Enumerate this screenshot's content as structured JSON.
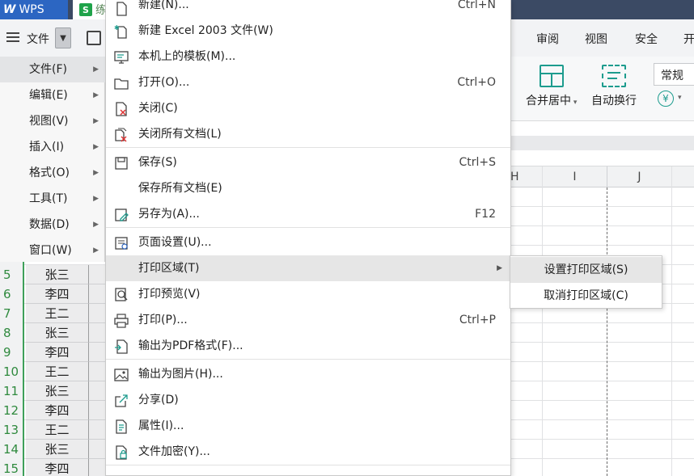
{
  "titlebar": {
    "app_label": "WPS",
    "doc_icon": "S",
    "doc_label": "练"
  },
  "menubar": {
    "file_label": "文件",
    "tabs": [
      "审阅",
      "视图",
      "安全",
      "开"
    ]
  },
  "ribbon": {
    "merge_label": "合并居中",
    "wrap_label": "自动换行",
    "format_value": "常规",
    "currency_symbol": "¥"
  },
  "columns": [
    "H",
    "I",
    "J"
  ],
  "left_menu": [
    {
      "label": "文件(F)",
      "active": true
    },
    {
      "label": "编辑(E)"
    },
    {
      "label": "视图(V)"
    },
    {
      "label": "插入(I)"
    },
    {
      "label": "格式(O)"
    },
    {
      "label": "工具(T)"
    },
    {
      "label": "数据(D)"
    },
    {
      "label": "窗口(W)"
    }
  ],
  "file_menu": [
    {
      "label": "新建(N)...",
      "shortcut": "Ctrl+N",
      "icon": "new-doc-icon"
    },
    {
      "label": "新建 Excel 2003 文件(W)",
      "shortcut": "",
      "icon": "new-excel-icon"
    },
    {
      "label": "本机上的模板(M)...",
      "shortcut": "",
      "icon": "template-icon"
    },
    {
      "label": "打开(O)...",
      "shortcut": "Ctrl+O",
      "icon": "folder-open-icon"
    },
    {
      "label": "关闭(C)",
      "shortcut": "",
      "icon": "close-doc-icon"
    },
    {
      "label": "关闭所有文档(L)",
      "shortcut": "",
      "icon": "close-all-icon"
    },
    {
      "label": "保存(S)",
      "shortcut": "Ctrl+S",
      "icon": "save-icon"
    },
    {
      "label": "保存所有文档(E)",
      "shortcut": "",
      "icon": ""
    },
    {
      "label": "另存为(A)...",
      "shortcut": "F12",
      "icon": "save-as-icon"
    },
    {
      "label": "页面设置(U)...",
      "shortcut": "",
      "icon": "page-setup-icon"
    },
    {
      "label": "打印区域(T)",
      "shortcut": "",
      "icon": ""
    },
    {
      "label": "打印预览(V)",
      "shortcut": "",
      "icon": "print-preview-icon"
    },
    {
      "label": "打印(P)...",
      "shortcut": "Ctrl+P",
      "icon": "printer-icon"
    },
    {
      "label": "输出为PDF格式(F)...",
      "shortcut": "",
      "icon": "pdf-export-icon"
    },
    {
      "label": "输出为图片(H)...",
      "shortcut": "",
      "icon": "image-export-icon"
    },
    {
      "label": "分享(D)",
      "shortcut": "",
      "icon": "share-icon"
    },
    {
      "label": "属性(I)...",
      "shortcut": "",
      "icon": "properties-icon"
    },
    {
      "label": "文件加密(Y)...",
      "shortcut": "",
      "icon": "encrypt-icon"
    }
  ],
  "print_area_submenu": [
    {
      "label": "设置打印区域(S)"
    },
    {
      "label": "取消打印区域(C)"
    }
  ],
  "rows": [
    {
      "num": "5",
      "name": "张三"
    },
    {
      "num": "6",
      "name": "李四"
    },
    {
      "num": "7",
      "name": "王二"
    },
    {
      "num": "8",
      "name": "张三"
    },
    {
      "num": "9",
      "name": "李四"
    },
    {
      "num": "10",
      "name": "王二"
    },
    {
      "num": "11",
      "name": "张三"
    },
    {
      "num": "12",
      "name": "李四"
    },
    {
      "num": "13",
      "name": "王二"
    },
    {
      "num": "14",
      "name": "张三"
    },
    {
      "num": "15",
      "name": "李四"
    }
  ],
  "colors": {
    "accent_teal": "#1d9c8e",
    "row_green": "#2f8a3e",
    "wps_blue": "#2c66c2",
    "title_dark": "#3b4a64"
  }
}
